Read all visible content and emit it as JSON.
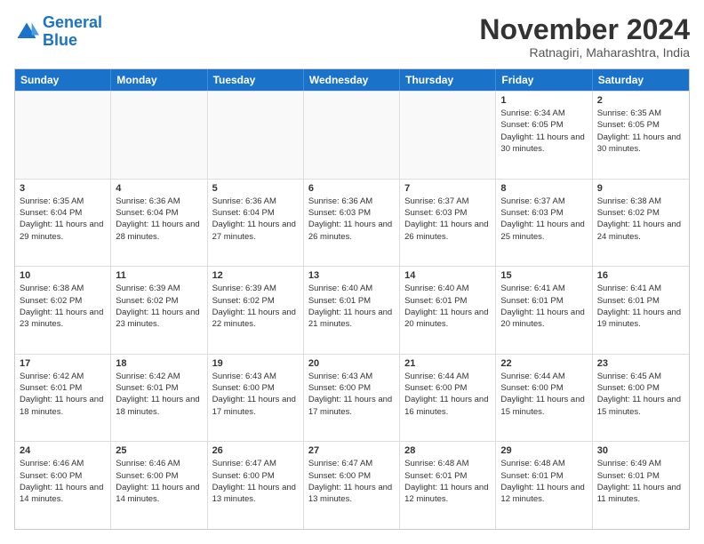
{
  "logo": {
    "line1": "General",
    "line2": "Blue"
  },
  "title": "November 2024",
  "location": "Ratnagiri, Maharashtra, India",
  "header_days": [
    "Sunday",
    "Monday",
    "Tuesday",
    "Wednesday",
    "Thursday",
    "Friday",
    "Saturday"
  ],
  "weeks": [
    [
      {
        "day": "",
        "empty": true
      },
      {
        "day": "",
        "empty": true
      },
      {
        "day": "",
        "empty": true
      },
      {
        "day": "",
        "empty": true
      },
      {
        "day": "",
        "empty": true
      },
      {
        "day": "1",
        "sunrise": "Sunrise: 6:34 AM",
        "sunset": "Sunset: 6:05 PM",
        "daylight": "Daylight: 11 hours and 30 minutes."
      },
      {
        "day": "2",
        "sunrise": "Sunrise: 6:35 AM",
        "sunset": "Sunset: 6:05 PM",
        "daylight": "Daylight: 11 hours and 30 minutes."
      }
    ],
    [
      {
        "day": "3",
        "sunrise": "Sunrise: 6:35 AM",
        "sunset": "Sunset: 6:04 PM",
        "daylight": "Daylight: 11 hours and 29 minutes."
      },
      {
        "day": "4",
        "sunrise": "Sunrise: 6:36 AM",
        "sunset": "Sunset: 6:04 PM",
        "daylight": "Daylight: 11 hours and 28 minutes."
      },
      {
        "day": "5",
        "sunrise": "Sunrise: 6:36 AM",
        "sunset": "Sunset: 6:04 PM",
        "daylight": "Daylight: 11 hours and 27 minutes."
      },
      {
        "day": "6",
        "sunrise": "Sunrise: 6:36 AM",
        "sunset": "Sunset: 6:03 PM",
        "daylight": "Daylight: 11 hours and 26 minutes."
      },
      {
        "day": "7",
        "sunrise": "Sunrise: 6:37 AM",
        "sunset": "Sunset: 6:03 PM",
        "daylight": "Daylight: 11 hours and 26 minutes."
      },
      {
        "day": "8",
        "sunrise": "Sunrise: 6:37 AM",
        "sunset": "Sunset: 6:03 PM",
        "daylight": "Daylight: 11 hours and 25 minutes."
      },
      {
        "day": "9",
        "sunrise": "Sunrise: 6:38 AM",
        "sunset": "Sunset: 6:02 PM",
        "daylight": "Daylight: 11 hours and 24 minutes."
      }
    ],
    [
      {
        "day": "10",
        "sunrise": "Sunrise: 6:38 AM",
        "sunset": "Sunset: 6:02 PM",
        "daylight": "Daylight: 11 hours and 23 minutes."
      },
      {
        "day": "11",
        "sunrise": "Sunrise: 6:39 AM",
        "sunset": "Sunset: 6:02 PM",
        "daylight": "Daylight: 11 hours and 23 minutes."
      },
      {
        "day": "12",
        "sunrise": "Sunrise: 6:39 AM",
        "sunset": "Sunset: 6:02 PM",
        "daylight": "Daylight: 11 hours and 22 minutes."
      },
      {
        "day": "13",
        "sunrise": "Sunrise: 6:40 AM",
        "sunset": "Sunset: 6:01 PM",
        "daylight": "Daylight: 11 hours and 21 minutes."
      },
      {
        "day": "14",
        "sunrise": "Sunrise: 6:40 AM",
        "sunset": "Sunset: 6:01 PM",
        "daylight": "Daylight: 11 hours and 20 minutes."
      },
      {
        "day": "15",
        "sunrise": "Sunrise: 6:41 AM",
        "sunset": "Sunset: 6:01 PM",
        "daylight": "Daylight: 11 hours and 20 minutes."
      },
      {
        "day": "16",
        "sunrise": "Sunrise: 6:41 AM",
        "sunset": "Sunset: 6:01 PM",
        "daylight": "Daylight: 11 hours and 19 minutes."
      }
    ],
    [
      {
        "day": "17",
        "sunrise": "Sunrise: 6:42 AM",
        "sunset": "Sunset: 6:01 PM",
        "daylight": "Daylight: 11 hours and 18 minutes."
      },
      {
        "day": "18",
        "sunrise": "Sunrise: 6:42 AM",
        "sunset": "Sunset: 6:01 PM",
        "daylight": "Daylight: 11 hours and 18 minutes."
      },
      {
        "day": "19",
        "sunrise": "Sunrise: 6:43 AM",
        "sunset": "Sunset: 6:00 PM",
        "daylight": "Daylight: 11 hours and 17 minutes."
      },
      {
        "day": "20",
        "sunrise": "Sunrise: 6:43 AM",
        "sunset": "Sunset: 6:00 PM",
        "daylight": "Daylight: 11 hours and 17 minutes."
      },
      {
        "day": "21",
        "sunrise": "Sunrise: 6:44 AM",
        "sunset": "Sunset: 6:00 PM",
        "daylight": "Daylight: 11 hours and 16 minutes."
      },
      {
        "day": "22",
        "sunrise": "Sunrise: 6:44 AM",
        "sunset": "Sunset: 6:00 PM",
        "daylight": "Daylight: 11 hours and 15 minutes."
      },
      {
        "day": "23",
        "sunrise": "Sunrise: 6:45 AM",
        "sunset": "Sunset: 6:00 PM",
        "daylight": "Daylight: 11 hours and 15 minutes."
      }
    ],
    [
      {
        "day": "24",
        "sunrise": "Sunrise: 6:46 AM",
        "sunset": "Sunset: 6:00 PM",
        "daylight": "Daylight: 11 hours and 14 minutes."
      },
      {
        "day": "25",
        "sunrise": "Sunrise: 6:46 AM",
        "sunset": "Sunset: 6:00 PM",
        "daylight": "Daylight: 11 hours and 14 minutes."
      },
      {
        "day": "26",
        "sunrise": "Sunrise: 6:47 AM",
        "sunset": "Sunset: 6:00 PM",
        "daylight": "Daylight: 11 hours and 13 minutes."
      },
      {
        "day": "27",
        "sunrise": "Sunrise: 6:47 AM",
        "sunset": "Sunset: 6:00 PM",
        "daylight": "Daylight: 11 hours and 13 minutes."
      },
      {
        "day": "28",
        "sunrise": "Sunrise: 6:48 AM",
        "sunset": "Sunset: 6:01 PM",
        "daylight": "Daylight: 11 hours and 12 minutes."
      },
      {
        "day": "29",
        "sunrise": "Sunrise: 6:48 AM",
        "sunset": "Sunset: 6:01 PM",
        "daylight": "Daylight: 11 hours and 12 minutes."
      },
      {
        "day": "30",
        "sunrise": "Sunrise: 6:49 AM",
        "sunset": "Sunset: 6:01 PM",
        "daylight": "Daylight: 11 hours and 11 minutes."
      }
    ]
  ]
}
